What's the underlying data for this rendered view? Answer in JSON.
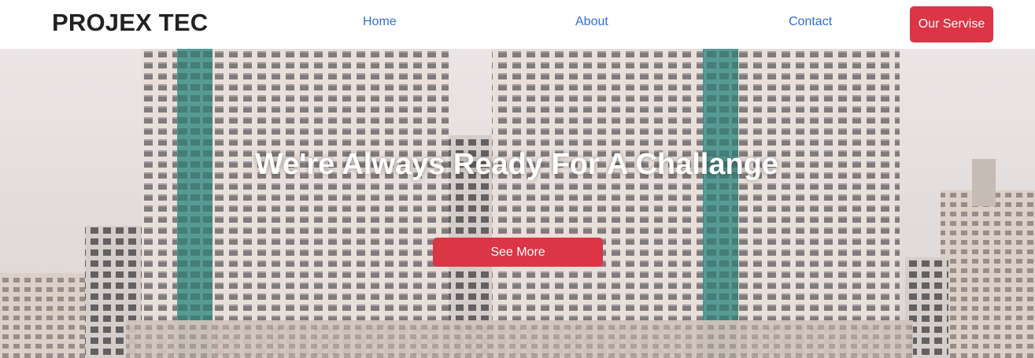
{
  "navbar": {
    "brand": "PROJEX TEC",
    "links": [
      "Home",
      "About",
      "Contact"
    ],
    "service_button": "Our Servise"
  },
  "hero": {
    "title": "We're Always Ready For A Challange",
    "cta_button": "See More",
    "background_image": "city-highrise-buildings-photo"
  },
  "colors": {
    "accent": "#dc3545",
    "link": "#2f6fd6",
    "brand_text": "#222222"
  }
}
